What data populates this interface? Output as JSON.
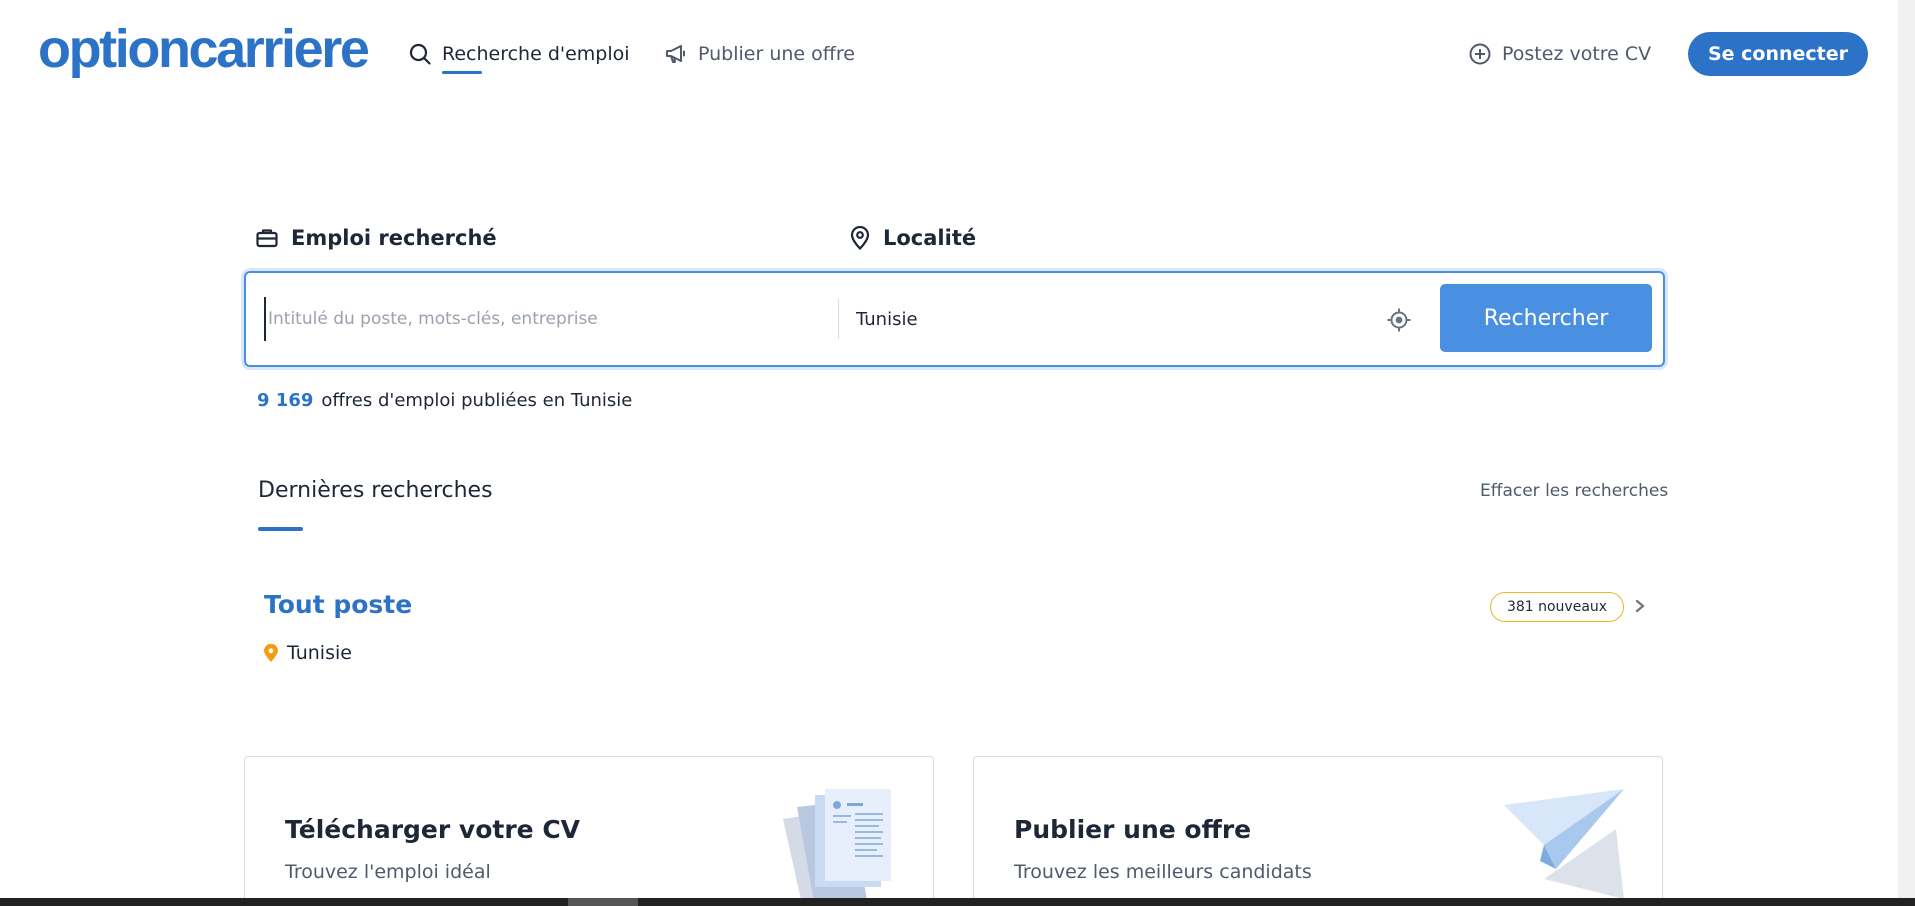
{
  "header": {
    "logo_text": "optioncarriere",
    "nav_search": "Recherche d'emploi",
    "nav_publish": "Publier une offre",
    "nav_cv": "Postez votre CV",
    "login_label": "Se connecter"
  },
  "search": {
    "job_label": "Emploi recherché",
    "location_label": "Localité",
    "job_placeholder": "Intitulé du poste, mots-clés, entreprise",
    "job_value": "",
    "location_value": "Tunisie",
    "submit_label": "Rechercher",
    "count_number": "9 169",
    "count_text": "offres d'emploi publiées en Tunisie"
  },
  "recent": {
    "title": "Dernières recherches",
    "clear_label": "Effacer les recherches",
    "items": [
      {
        "job": "Tout poste",
        "location": "Tunisie",
        "badge": "381 nouveaux"
      }
    ]
  },
  "cards": [
    {
      "title": "Télécharger votre CV",
      "subtitle": "Trouvez l'emploi idéal",
      "icon": "cv-document-icon"
    },
    {
      "title": "Publier une offre",
      "subtitle": "Trouvez les meilleurs candidats",
      "icon": "paper-plane-icon"
    }
  ],
  "colors": {
    "brand_blue": "#2c72c7",
    "button_blue": "#4a90e2",
    "badge_border": "#f0b429",
    "pin_orange": "#f39c12"
  }
}
